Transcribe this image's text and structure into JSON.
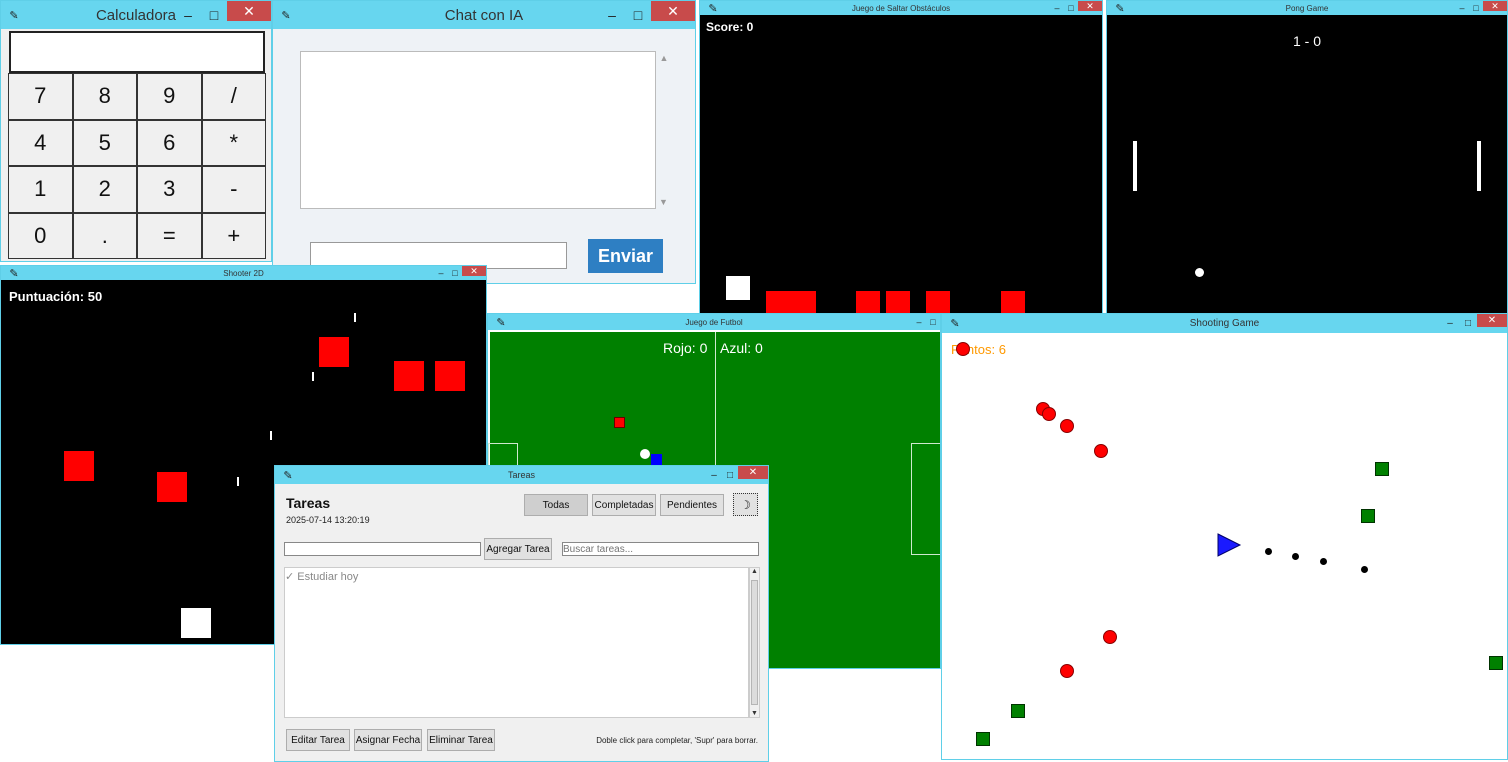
{
  "calculadora": {
    "title": "Calculadora",
    "display_value": "",
    "keys": [
      "7",
      "8",
      "9",
      "/",
      "4",
      "5",
      "6",
      "*",
      "1",
      "2",
      "3",
      "-",
      "0",
      ".",
      "=",
      "+"
    ]
  },
  "chat": {
    "title": "Chat con IA",
    "send_label": "Enviar",
    "input_value": ""
  },
  "obstacles": {
    "title": "Juego de Saltar Obstáculos",
    "score": "Score: 0"
  },
  "pong": {
    "title": "Pong Game",
    "score": "1 - 0"
  },
  "shooter": {
    "title": "Shooter 2D",
    "score": "Puntuación: 50"
  },
  "futbol": {
    "title": "Juego de Futbol",
    "rojo": "Rojo: 0",
    "azul": "Azul: 0"
  },
  "shooting": {
    "title": "Shooting Game",
    "score": "Puntos: 6"
  },
  "tareas": {
    "title": "Tareas",
    "heading": "Tareas",
    "datetime": "2025-07-14 13:20:19",
    "filters": [
      "Todas",
      "Completadas",
      "Pendientes"
    ],
    "theme_icon": "☽",
    "add_label": "Agregar Tarea",
    "task_input_value": "",
    "search_placeholder": "Buscar tareas...",
    "tasks": [
      "✓ Estudiar hoy"
    ],
    "edit_label": "Editar Tarea",
    "date_label": "Asignar Fecha",
    "delete_label": "Eliminar Tarea",
    "hint": "Doble click para completar, 'Supr' para borrar."
  },
  "window_controls": {
    "minimize": "–",
    "maximize": "□",
    "close": "✕"
  },
  "icons": {
    "feather": "feather-icon"
  }
}
